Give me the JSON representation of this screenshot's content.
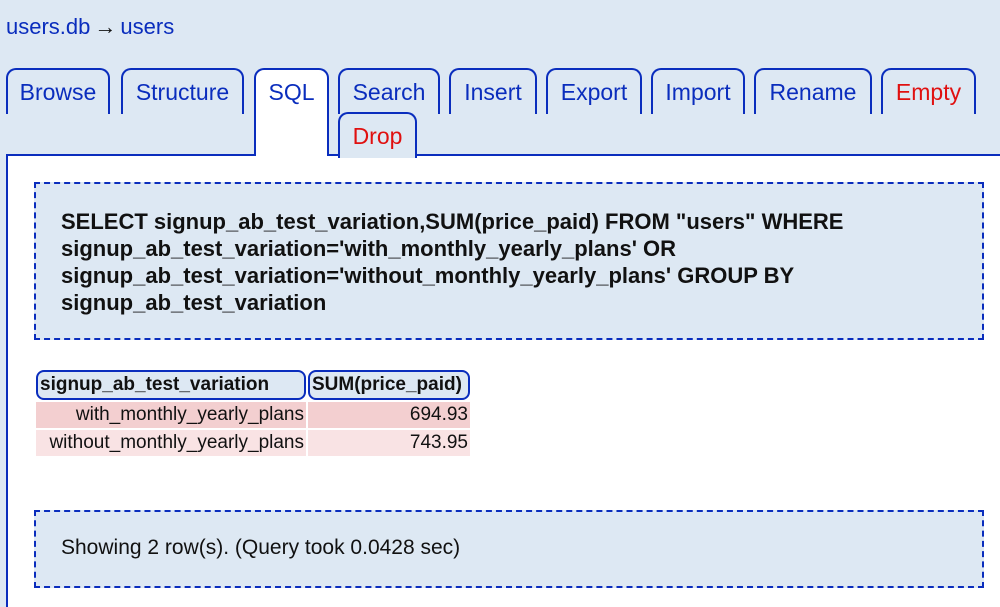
{
  "breadcrumb": {
    "database": "users.db",
    "separator": "→",
    "table": "users"
  },
  "tabs": [
    {
      "label": "Browse"
    },
    {
      "label": "Structure"
    },
    {
      "label": "SQL"
    },
    {
      "label": "Search"
    },
    {
      "label": "Insert"
    },
    {
      "label": "Export"
    },
    {
      "label": "Import"
    },
    {
      "label": "Rename"
    },
    {
      "label": "Empty"
    },
    {
      "label": "Drop"
    }
  ],
  "active_tab": "SQL",
  "query": {
    "line1": "SELECT signup_ab_test_variation,SUM(price_paid) FROM \"users\" WHERE",
    "line2": "signup_ab_test_variation='with_monthly_yearly_plans' OR",
    "line3": "signup_ab_test_variation='without_monthly_yearly_plans' GROUP BY",
    "line4": "signup_ab_test_variation"
  },
  "results": {
    "columns": [
      "signup_ab_test_variation",
      "SUM(price_paid)"
    ],
    "rows": [
      [
        "with_monthly_yearly_plans",
        "694.93"
      ],
      [
        "without_monthly_yearly_plans",
        "743.95"
      ]
    ]
  },
  "status": "Showing 2 row(s). (Query took 0.0428 sec)",
  "colors": {
    "link": "#0a2dbd",
    "danger": "#e01010",
    "panel": "#dde8f3",
    "row_odd": "#f3cfd0",
    "row_even": "#f9e3e4"
  }
}
